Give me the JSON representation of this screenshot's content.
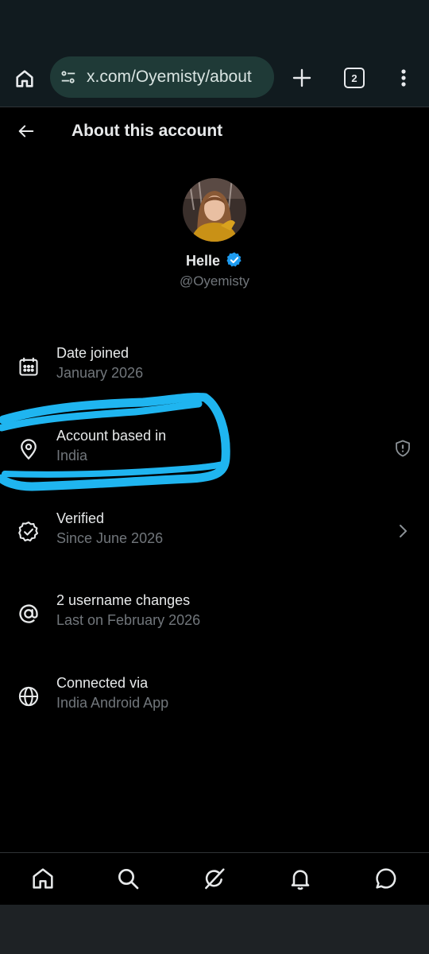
{
  "browser": {
    "url": "x.com/Oyemisty/about",
    "tab_count": "2"
  },
  "header": {
    "title": "About this account"
  },
  "profile": {
    "display_name": "Helle",
    "handle": "@Oyemisty"
  },
  "rows": [
    {
      "label": "Date joined",
      "value": "January 2026",
      "icon": "calendar-icon"
    },
    {
      "label": "Account based in",
      "value": "India",
      "icon": "location-pin-icon",
      "action_icon": "shield-alert-icon"
    },
    {
      "label": "Verified",
      "value": "Since June 2026",
      "icon": "verified-badge-icon",
      "action_icon": "chevron-right-icon"
    },
    {
      "label": "2 username changes",
      "value": "Last on February 2026",
      "icon": "at-sign-icon"
    },
    {
      "label": "Connected via",
      "value": "India Android App",
      "icon": "globe-icon"
    }
  ],
  "colors": {
    "background": "#000000",
    "browser_bar": "#111b1f",
    "url_pill": "#1f3a37",
    "verified_blue": "#1d9bf0",
    "annotation_cyan": "#1fb5f0",
    "secondary_text": "#71767b"
  },
  "bottom_nav": [
    {
      "icon": "home-icon"
    },
    {
      "icon": "search-icon"
    },
    {
      "icon": "grok-icon"
    },
    {
      "icon": "bell-icon"
    },
    {
      "icon": "messages-icon"
    }
  ]
}
